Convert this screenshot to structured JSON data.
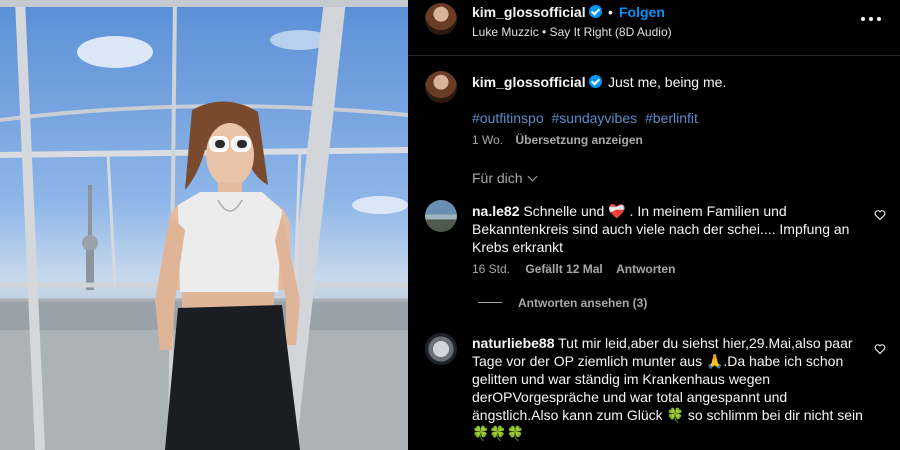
{
  "header": {
    "username": "kim_glossofficial",
    "separator": "•",
    "follow_label": "Folgen",
    "audio": "Luke Muzzic • Say It Right (8D Audio)",
    "more_icon": "more-horizontal-icon"
  },
  "caption": {
    "username": "kim_glossofficial",
    "text": "Just me, being me.",
    "hashtags": [
      "#outfitinspo",
      "#sundayvibes",
      "#berlinfit"
    ],
    "age": "1 Wo.",
    "translate_label": "Übersetzung anzeigen"
  },
  "filter": {
    "label": "Für dich"
  },
  "comments": [
    {
      "username": "na.le82",
      "text": "Schnelle und ❤️‍🩹 . In meinem Familien und Bekanntenkreis sind auch viele nach der schei.... Impfung an Krebs erkrankt",
      "age": "16 Std.",
      "likes": "Gefällt 12 Mal",
      "reply_label": "Antworten",
      "view_replies": "Antworten ansehen (3)"
    },
    {
      "username": "naturliebe88",
      "text": "Tut mir leid,aber du siehst hier,29.Mai,also paar Tage vor der OP ziemlich munter aus 🙏.Da habe ich schon gelitten und war ständig im Krankenhaus wegen derOPVorgespräche und war total angespannt und ängstlich.Also kann zum Glück 🍀 so schlimm bei dir nicht sein 🍀🍀🍀"
    }
  ],
  "colors": {
    "background": "#000000",
    "accent": "#0095f6",
    "hashtag": "#5b8cc9",
    "secondary_text": "#a8a8a8"
  }
}
